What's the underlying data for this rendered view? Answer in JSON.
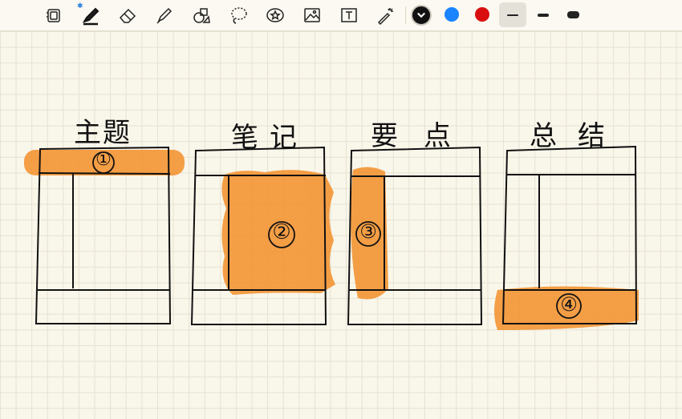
{
  "toolbar": {
    "tools": [
      {
        "name": "page-layout-icon"
      },
      {
        "name": "pen-tool-icon",
        "bluetooth": true
      },
      {
        "name": "eraser-icon"
      },
      {
        "name": "highlighter-icon"
      },
      {
        "name": "shapes-icon"
      },
      {
        "name": "lasso-icon"
      },
      {
        "name": "sticker-icon"
      },
      {
        "name": "image-icon"
      },
      {
        "name": "text-box-icon"
      },
      {
        "name": "laser-pointer-icon"
      }
    ],
    "colors": [
      "#000000",
      "#1a84ff",
      "#d90f0f"
    ],
    "selected_color": "#000000",
    "stroke_widths": [
      "thin",
      "medium",
      "thick"
    ],
    "selected_width": "thin"
  },
  "highlight_color": "#f3922f",
  "sections": [
    {
      "title": "主题",
      "marker": "①"
    },
    {
      "title": "笔记",
      "marker": "②"
    },
    {
      "title": "要点",
      "marker": "③"
    },
    {
      "title": "总结",
      "marker": "④"
    }
  ]
}
